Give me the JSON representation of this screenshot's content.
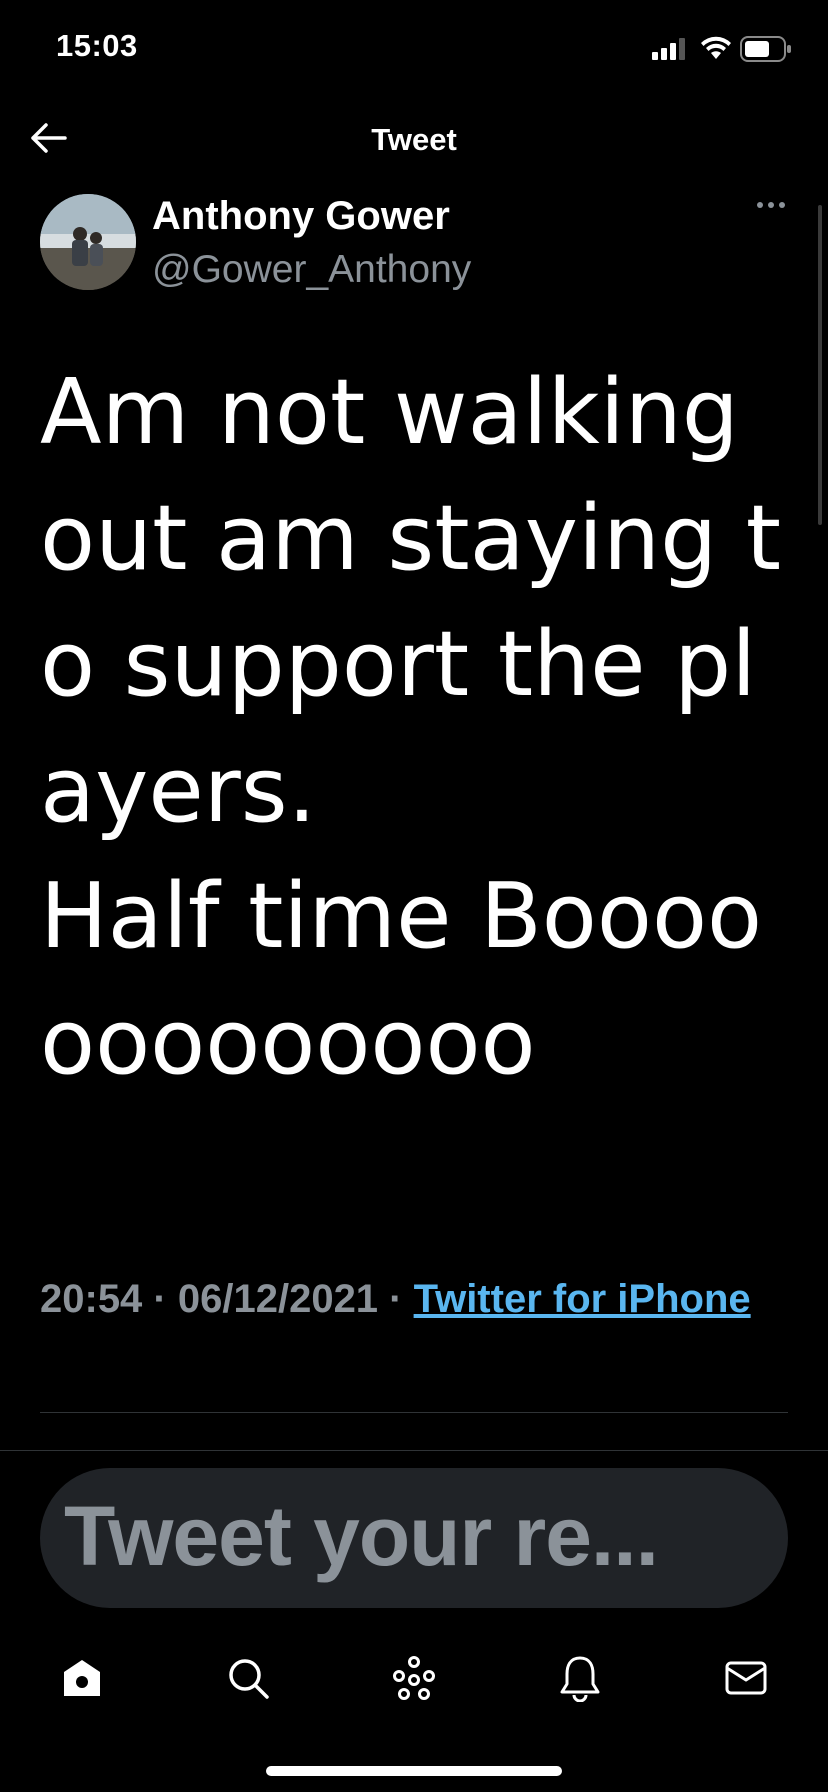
{
  "status_bar": {
    "time": "15:03"
  },
  "nav": {
    "title": "Tweet"
  },
  "author": {
    "name": "Anthony Gower",
    "handle": "@Gower_Anthony"
  },
  "tweet": {
    "text": "Am not walking out am staying to support the players.\nHalf time Booooooooooooo",
    "time": "20:54",
    "date": "06/12/2021",
    "source": "Twitter for iPhone"
  },
  "reply": {
    "placeholder": "Tweet your re..."
  },
  "tabs": [
    "home-icon",
    "search-icon",
    "spaces-icon",
    "notifications-icon",
    "messages-icon"
  ],
  "colors": {
    "background": "#000000",
    "link": "#5ab6f0",
    "secondary_text": "#8b9299",
    "reply_box": "#202327"
  }
}
